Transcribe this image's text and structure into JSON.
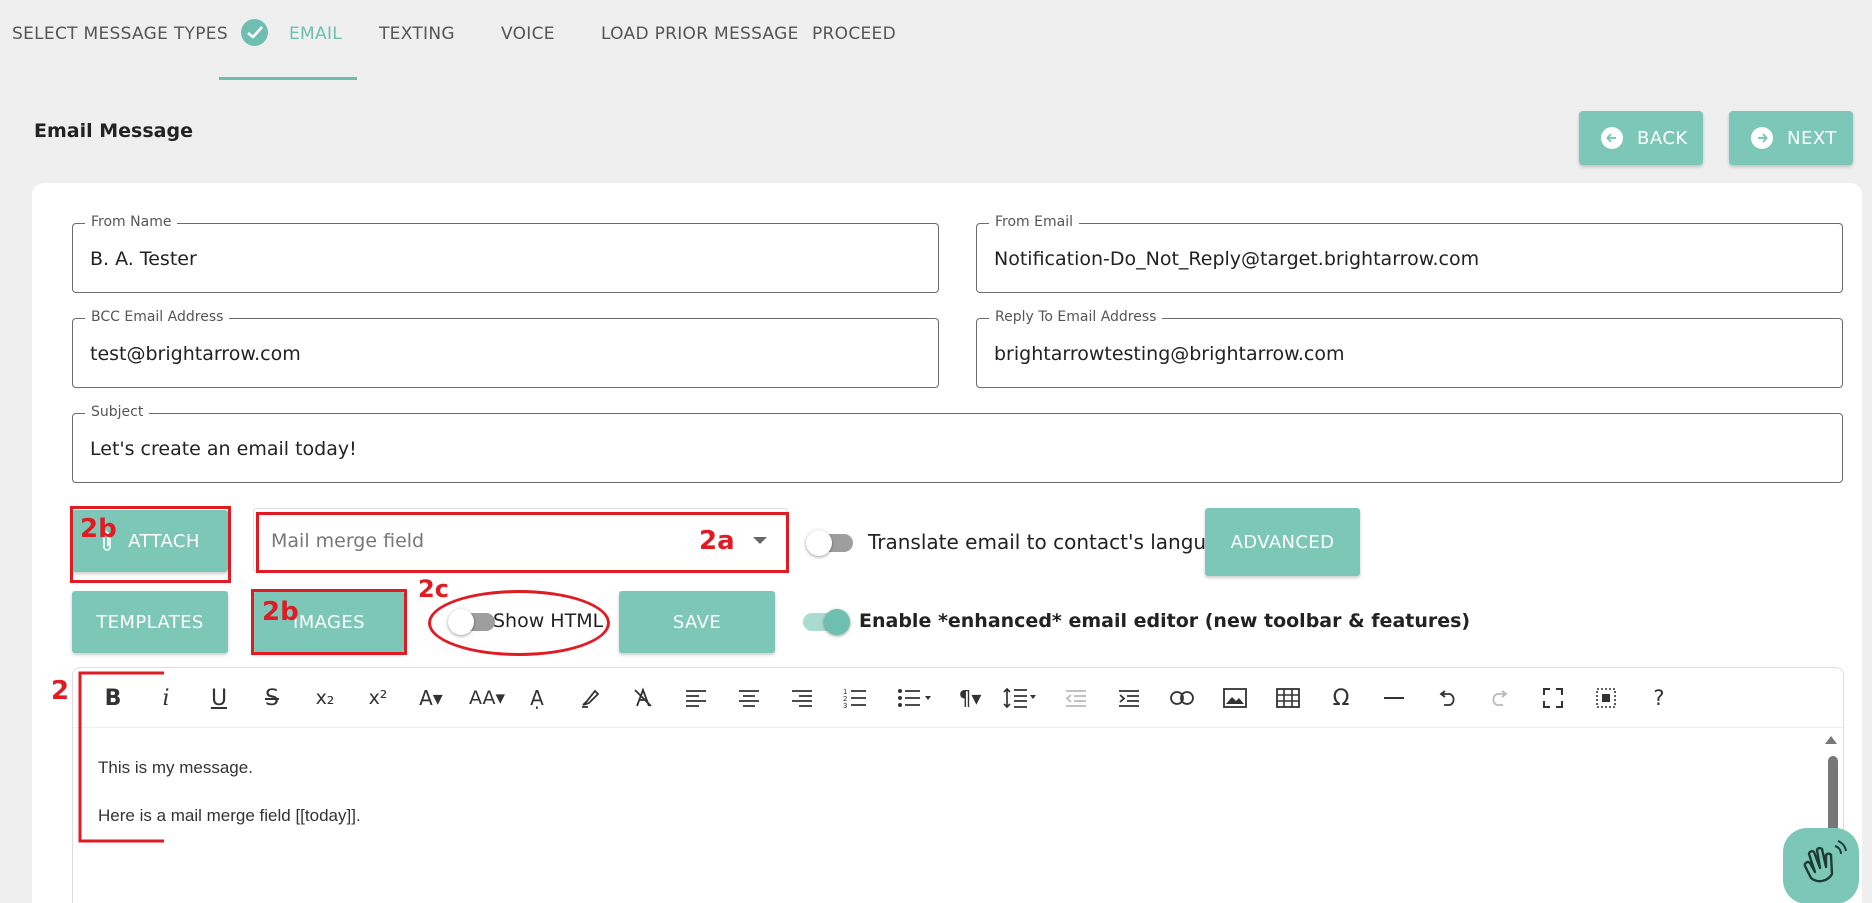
{
  "stepper": {
    "steps": [
      "SELECT MESSAGE TYPES",
      "EMAIL",
      "TEXTING",
      "VOICE",
      "LOAD PRIOR MESSAGE",
      "PROCEED"
    ]
  },
  "page": {
    "title": "Email Message"
  },
  "nav": {
    "back_label": "BACK",
    "next_label": "NEXT"
  },
  "form": {
    "from_name": {
      "label": "From Name",
      "value": "B. A. Tester"
    },
    "from_email": {
      "label": "From Email",
      "value": "Notification-Do_Not_Reply@target.brightarrow.com"
    },
    "bcc": {
      "label": "BCC Email Address",
      "value": "test@brightarrow.com"
    },
    "reply_to": {
      "label": "Reply To Email Address",
      "value": "brightarrowtesting@brightarrow.com"
    },
    "subject": {
      "label": "Subject",
      "value": "Let's create an email today!"
    }
  },
  "controls": {
    "attach_label": "ATTACH",
    "merge_placeholder": "Mail merge field",
    "translate_label": "Translate email to contact's language",
    "translate_on": false,
    "advanced_label": "ADVANCED",
    "templates_label": "TEMPLATES",
    "images_label": "IMAGES",
    "show_html_label": "Show HTML",
    "show_html_on": false,
    "save_label": "SAVE",
    "enhanced_label": "Enable *enhanced* email editor (new toolbar & features)",
    "enhanced_on": true
  },
  "editor": {
    "toolbar": [
      "bold",
      "italic",
      "underline",
      "strikethrough",
      "subscript",
      "superscript",
      "font-color",
      "font-size",
      "text-color",
      "highlight",
      "clear-format",
      "align-left",
      "align-center",
      "align-right",
      "ordered-list",
      "bullet-list",
      "paragraph",
      "line-height",
      "outdent",
      "indent",
      "link",
      "image",
      "table",
      "special-char",
      "horizontal-rule",
      "undo",
      "redo",
      "fullscreen",
      "select-all",
      "help"
    ],
    "lines": [
      "This is my message.",
      "Here is a mail merge field [[today]]."
    ]
  },
  "annotations": {
    "attach": "2b",
    "merge": "2a",
    "images": "2b",
    "show_html": "2c",
    "editor": "2"
  },
  "colors": {
    "accent": "#7cc7b8",
    "annotation": "#e01b24"
  }
}
